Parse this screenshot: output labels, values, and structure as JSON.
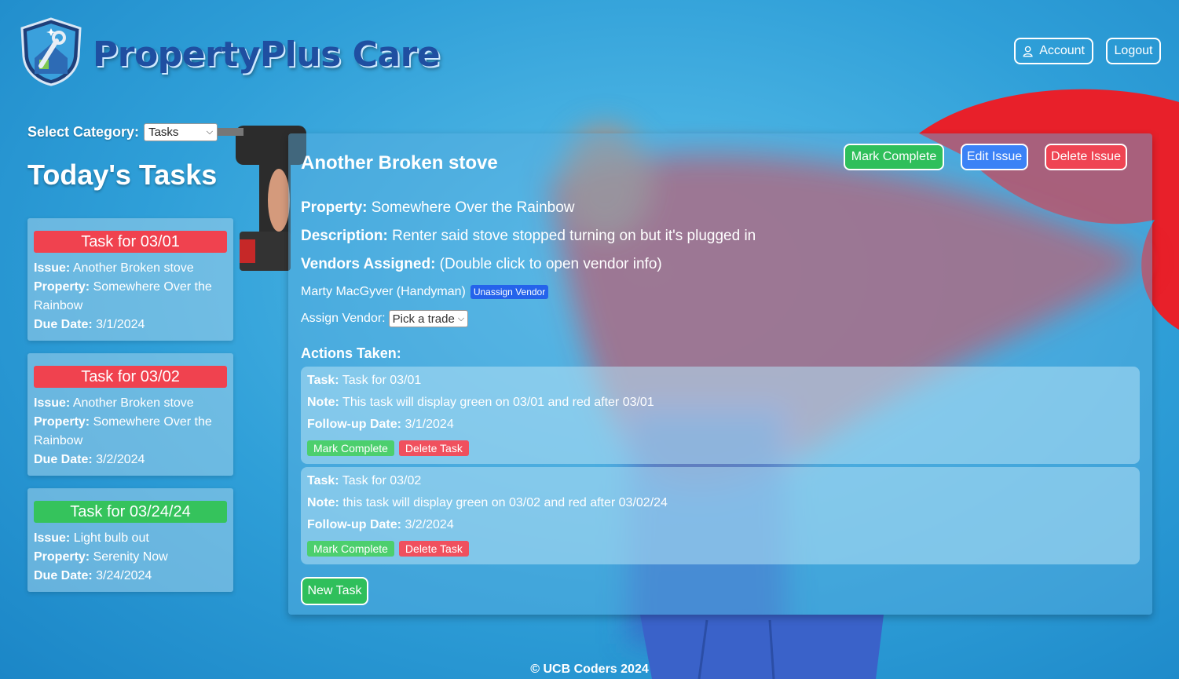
{
  "brand": {
    "name": "PropertyPlus Care",
    "logo_icon": "shield-house-wrench-icon"
  },
  "header": {
    "account_label": "Account",
    "logout_label": "Logout",
    "account_icon": "user-icon"
  },
  "sidebar": {
    "category_label": "Select Category:",
    "category_value": "Tasks",
    "heading": "Today's Tasks",
    "cards": [
      {
        "title": "Task for 03/01",
        "status": "overdue",
        "issue_label": "Issue:",
        "issue": "Another Broken stove",
        "property_label": "Property:",
        "property": "Somewhere Over the Rainbow",
        "due_label": "Due Date:",
        "due": "3/1/2024"
      },
      {
        "title": "Task for 03/02",
        "status": "overdue",
        "issue_label": "Issue:",
        "issue": "Another Broken stove",
        "property_label": "Property:",
        "property": "Somewhere Over the Rainbow",
        "due_label": "Due Date:",
        "due": "3/2/2024"
      },
      {
        "title": "Task for 03/24/24",
        "status": "on-time",
        "issue_label": "Issue:",
        "issue": "Light bulb out",
        "property_label": "Property:",
        "property": "Serenity Now",
        "due_label": "Due Date:",
        "due": "3/24/2024"
      }
    ]
  },
  "issue": {
    "title": "Another Broken stove",
    "mark_complete_label": "Mark Complete",
    "edit_label": "Edit Issue",
    "delete_label": "Delete Issue",
    "property_label": "Property:",
    "property": "Somewhere Over the Rainbow",
    "description_label": "Description:",
    "description": "Renter said stove stopped turning on but it's plugged in",
    "vendors_label": "Vendors Assigned:",
    "vendors_hint": "(Double click to open vendor info)",
    "vendor_name": "Marty MacGyver (Handyman)",
    "unassign_label": "Unassign Vendor",
    "assign_label": "Assign Vendor:",
    "assign_placeholder": "Pick a trade",
    "actions_heading": "Actions Taken:",
    "actions": [
      {
        "task_label": "Task:",
        "task": "Task for 03/01",
        "note_label": "Note:",
        "note": "This task will display green on 03/01 and red after 03/01",
        "followup_label": "Follow-up Date:",
        "followup": "3/1/2024",
        "complete_label": "Mark Complete",
        "delete_label": "Delete Task"
      },
      {
        "task_label": "Task:",
        "task": "Task for 03/02",
        "note_label": "Note:",
        "note": "this task will display green on 03/02 and red after 03/02/24",
        "followup_label": "Follow-up Date:",
        "followup": "3/2/2024",
        "complete_label": "Mark Complete",
        "delete_label": "Delete Task"
      }
    ],
    "new_task_label": "New Task"
  },
  "footer": {
    "text": "© UCB Coders 2024"
  },
  "colors": {
    "overdue": "#f0424f",
    "on_time": "#35c35c",
    "edit": "#3b82f6",
    "brand_text": "#1f4fa1"
  }
}
